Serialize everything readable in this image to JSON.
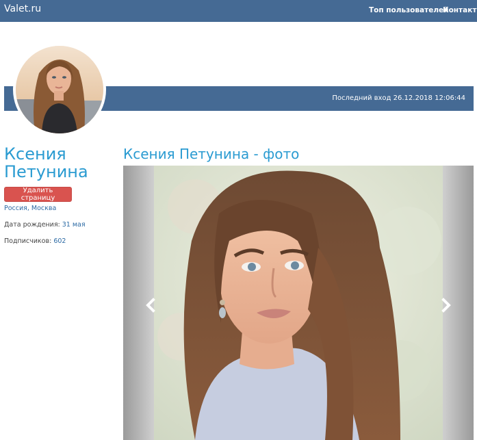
{
  "header": {
    "brand": "Valet.ru",
    "nav": [
      "Топ пользователей",
      "Контакты"
    ]
  },
  "profile": {
    "last_visit": "Последний вход 26.12.2018 12:06:44",
    "name": "Ксения Петунина",
    "delete_label": "Удалить страницу",
    "location": "Россия, Москва",
    "birthday_label": "Дата рождения:",
    "birthday_value": "31 мая",
    "subscribers_label": "Подписчиков:",
    "subscribers_value": "602"
  },
  "gallery": {
    "title": "Ксения Петунина - фото",
    "prev_icon": "chevron-left-icon",
    "next_icon": "chevron-right-icon"
  },
  "colors": {
    "header_bg": "#456a94",
    "accent_text": "#2a9bd1",
    "link": "#2c6aa4",
    "danger": "#d9534f"
  }
}
